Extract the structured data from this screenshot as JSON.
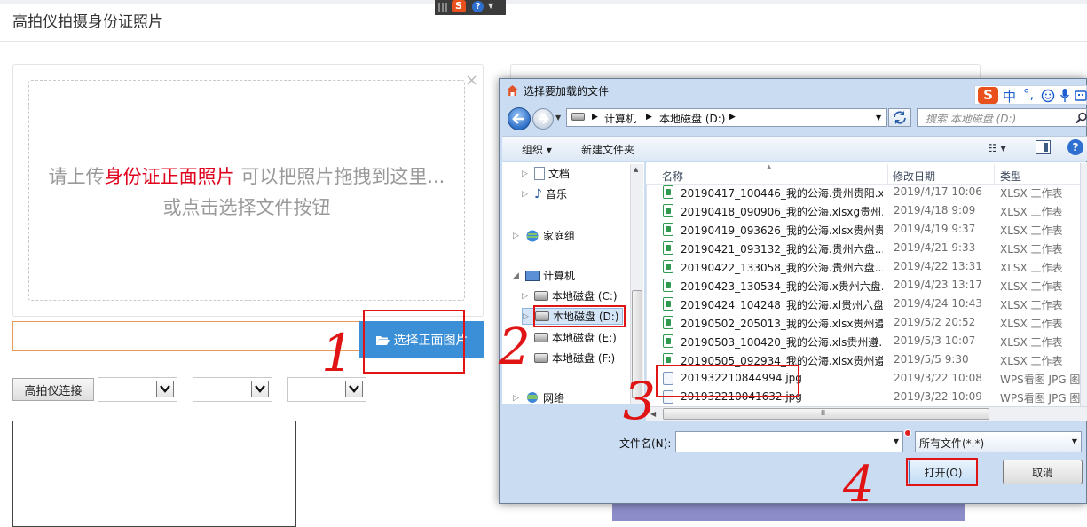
{
  "page": {
    "title": "高拍仪拍摄身份证照片",
    "drop_text_pre": "请上传",
    "drop_text_highlight": "身份证正面照片",
    "drop_text_post": " 可以把照片拖拽到这里... 或点击选择文件按钮",
    "select_front_label": "选择正面图片",
    "camera_connect_label": "高拍仪连接",
    "close_symbol": "×"
  },
  "ime_mini": {
    "logo": "S",
    "help": "?"
  },
  "dialog": {
    "title": "选择要加载的文件",
    "ime": {
      "logo": "S",
      "lang": "中",
      "punct": "°,"
    },
    "breadcrumb": [
      "计算机",
      "本地磁盘 (D:)"
    ],
    "search_placeholder": "搜索 本地磁盘 (D:)",
    "toolbar": {
      "organize": "组织 ▾",
      "new_folder": "新建文件夹",
      "view": "☷ ▾",
      "help": "?"
    },
    "tree": [
      {
        "label": "文档",
        "icon": "document-icon"
      },
      {
        "label": "音乐",
        "icon": "music-icon"
      },
      {
        "label": "家庭组",
        "icon": "homegroup-icon"
      },
      {
        "label": "计算机",
        "icon": "computer-icon"
      },
      {
        "label": "本地磁盘 (C:)",
        "icon": "drive-icon"
      },
      {
        "label": "本地磁盘 (D:)",
        "icon": "drive-icon",
        "selected": true
      },
      {
        "label": "本地磁盘 (E:)",
        "icon": "drive-icon"
      },
      {
        "label": "本地磁盘 (F:)",
        "icon": "drive-icon"
      },
      {
        "label": "网络",
        "icon": "network-icon"
      }
    ],
    "columns": [
      "名称",
      "修改日期",
      "类型"
    ],
    "files": [
      {
        "name": "20190417_100446_我的公海.贵州贵阳.x...",
        "date": "2019/4/17 10:06",
        "type": "XLSX 工作表",
        "kind": "xlsx"
      },
      {
        "name": "20190418_090906_我的公海.xlsxg贵州...",
        "date": "2019/4/18 9:09",
        "type": "XLSX 工作表",
        "kind": "xlsx"
      },
      {
        "name": "20190419_093626_我的公海.xlsx贵州贵...",
        "date": "2019/4/19 9:37",
        "type": "XLSX 工作表",
        "kind": "xlsx"
      },
      {
        "name": "20190421_093132_我的公海.贵州六盘...",
        "date": "2019/4/21 9:33",
        "type": "XLSX 工作表",
        "kind": "xlsx"
      },
      {
        "name": "20190422_133058_我的公海.贵州六盘...",
        "date": "2019/4/22 13:31",
        "type": "XLSX 工作表",
        "kind": "xlsx"
      },
      {
        "name": "20190423_130534_我的公海.x贵州六盘...",
        "date": "2019/4/23 13:17",
        "type": "XLSX 工作表",
        "kind": "xlsx"
      },
      {
        "name": "20190424_104248_我的公海.xl贵州六盘...",
        "date": "2019/4/24 10:43",
        "type": "XLSX 工作表",
        "kind": "xlsx"
      },
      {
        "name": "20190502_205013_我的公海.xlsx贵州遵...",
        "date": "2019/5/2 20:52",
        "type": "XLSX 工作表",
        "kind": "xlsx"
      },
      {
        "name": "20190503_100420_我的公海.xls贵州遵...",
        "date": "2019/5/3 10:07",
        "type": "XLSX 工作表",
        "kind": "xlsx"
      },
      {
        "name": "20190505_092934_我的公海.xlsx贵州遵...",
        "date": "2019/5/5 9:30",
        "type": "XLSX 工作表",
        "kind": "xlsx"
      },
      {
        "name": "201932210844994.jpg",
        "date": "2019/3/22 10:08",
        "type": "WPS看图 JPG 图",
        "kind": "jpg"
      },
      {
        "name": "201932210041632.jpg",
        "date": "2019/3/22 10:09",
        "type": "WPS看图 JPG 图",
        "kind": "jpg"
      }
    ],
    "filename_label": "文件名(N):",
    "filename_value": "",
    "filetype_value": "所有文件(*.*)",
    "open_label": "打开(O)",
    "cancel_label": "取消",
    "scroll_grip": "III"
  },
  "annotations": [
    "1",
    "2",
    "3",
    "4"
  ]
}
